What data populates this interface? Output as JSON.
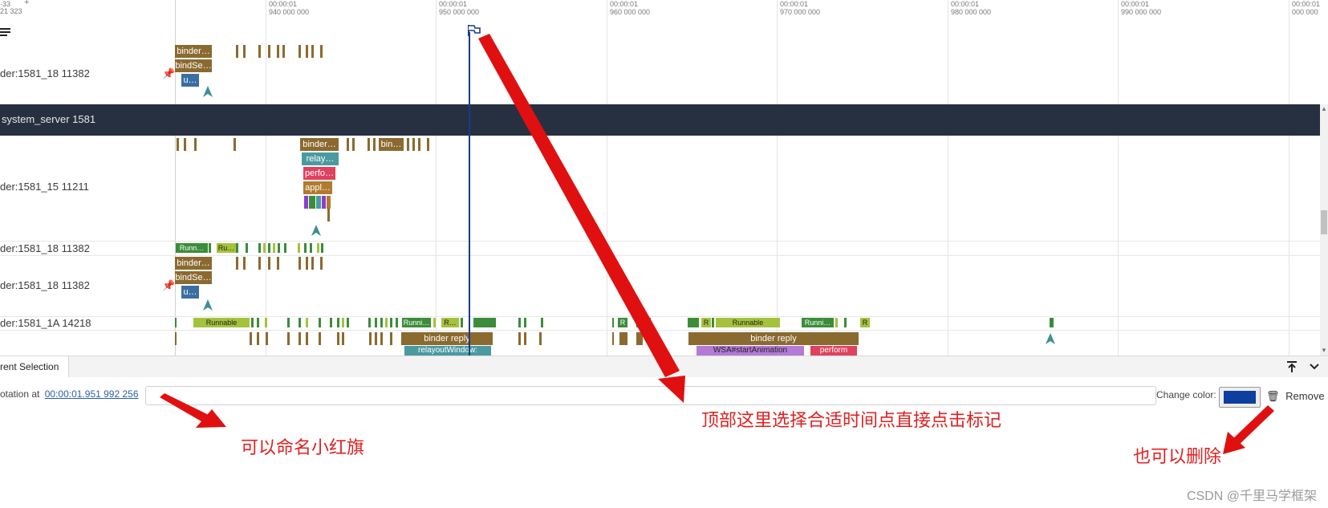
{
  "ruler": {
    "left_fragment": "·33",
    "left_fragment2": "21 323",
    "plus": "+",
    "ticks": [
      {
        "top": "00:00:01",
        "bottom": "940 000 000"
      },
      {
        "top": "00:00:01",
        "bottom": "950 000 000"
      },
      {
        "top": "00:00:01",
        "bottom": "960 000 000"
      },
      {
        "top": "00:00:01",
        "bottom": "970 000 000"
      },
      {
        "top": "00:00:01",
        "bottom": "980 000 000"
      },
      {
        "top": "00:00:01",
        "bottom": "990 000 000"
      },
      {
        "top": "00:00:01",
        "bottom": "000 000"
      }
    ]
  },
  "tracks": {
    "t1": "der:1581_18 11382",
    "group": "system_server 1581",
    "t2": "der:1581_15 11211",
    "t3": "der:1581_18 11382",
    "t4": "der:1581_18 11382",
    "t5": "der:1581_1A 14218"
  },
  "slices": {
    "binder1": "binder…",
    "bindse1": "bindSe…",
    "u1": "u…",
    "binder2": "binder…",
    "bin2": "bin…",
    "relay": "relay…",
    "perfo": "perfo…",
    "appl": "appl…",
    "runn1": "Runn…",
    "ru1": "Ru…",
    "binder3": "binder…",
    "bindse3": "bindSe…",
    "u3": "u…",
    "runnable1": "Runnable",
    "runni1": "Runni…",
    "r1": "R…",
    "r2": "R",
    "r3": "R",
    "runnable2": "Runnable",
    "runni2": "Runni…",
    "r4": "R",
    "binder_reply1": "binder reply",
    "relayout": "relayoutWindow:",
    "binder_reply2": "binder reply",
    "wsa": "WSA#startAnimation",
    "perform": "perform"
  },
  "bottom_panel": {
    "tab_label": "rent Selection",
    "annotation_prefix": "otation at",
    "annotation_time": "00:00:01.951 992 256",
    "name_input_value": "",
    "change_color_label": "Change color:",
    "flag_color": "#0d3f9e",
    "remove_label": "Remove"
  },
  "callouts": {
    "top": "顶部这里选择合适时间点直接点击标记",
    "name": "可以命名小红旗",
    "delete": "也可以删除"
  },
  "watermark": "CSDN @千里马学框架",
  "colors": {
    "binder": "#8b6a2f",
    "blue": "#3b6fa3",
    "teal": "#4a9aa0",
    "pink": "#e0415f",
    "tan": "#b07b2c",
    "green": "#3c8c3a",
    "lime": "#a5c23c",
    "purple": "#b47ad6",
    "flag_line": "#1a3b8a",
    "annotation_red": "#e02020"
  }
}
